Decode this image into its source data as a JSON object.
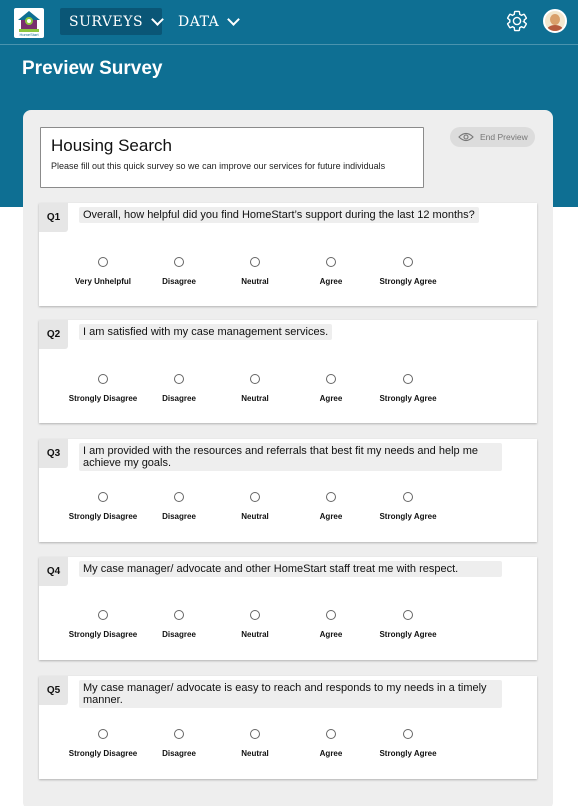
{
  "nav": {
    "logo_text": "HomeStart",
    "surveys_label": "SURVEYS",
    "data_label": "DATA"
  },
  "page": {
    "title": "Preview Survey"
  },
  "survey": {
    "title": "Housing Search",
    "description": "Please fill out this quick survey so we can improve our services for future individuals",
    "end_preview_label": "End Preview"
  },
  "questions": [
    {
      "num": "Q1",
      "text": "Overall, how helpful did you find HomeStart’s support during the last 12 months?",
      "options": [
        "Very Unhelpful",
        "Disagree",
        "Neutral",
        "Agree",
        "Strongly Agree"
      ]
    },
    {
      "num": "Q2",
      "text": "I am satisfied with my case management services.",
      "options": [
        "Strongly Disagree",
        "Disagree",
        "Neutral",
        "Agree",
        "Strongly Agree"
      ]
    },
    {
      "num": "Q3",
      "text": "I am provided with the resources and referrals that best fit my needs and help me achieve my goals.",
      "options": [
        "Strongly Disagree",
        "Disagree",
        "Neutral",
        "Agree",
        "Strongly Agree"
      ]
    },
    {
      "num": "Q4",
      "text": "My case manager/ advocate and other HomeStart staff treat me with respect.",
      "options": [
        "Strongly Disagree",
        "Disagree",
        "Neutral",
        "Agree",
        "Strongly Agree"
      ]
    },
    {
      "num": "Q5",
      "text": "My case manager/ advocate is easy to reach and responds to my needs in a timely manner.",
      "options": [
        "Strongly Disagree",
        "Disagree",
        "Neutral",
        "Agree",
        "Strongly Agree"
      ]
    }
  ],
  "colors": {
    "header_bg": "#0e6f93",
    "nav_active_bg": "#0a5676",
    "panel_bg": "#eeeeee",
    "card_bg": "#ffffff"
  },
  "icons": {
    "settings": "gear-icon",
    "profile": "avatar",
    "preview": "eye-icon",
    "dropdown": "chevron-down-icon"
  }
}
